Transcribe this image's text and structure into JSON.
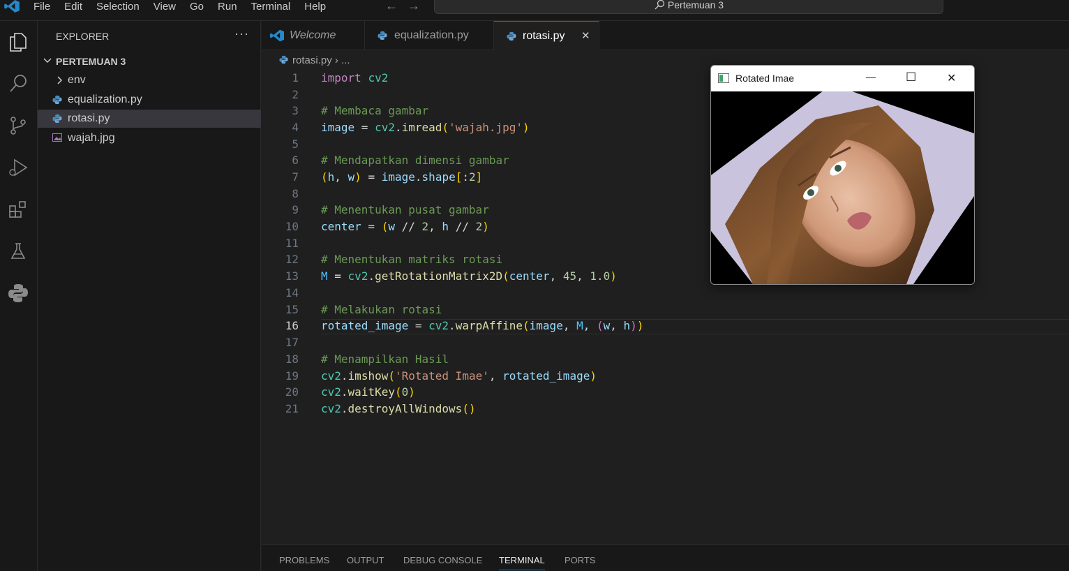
{
  "app": {
    "menu": [
      "File",
      "Edit",
      "Selection",
      "View",
      "Go",
      "Run",
      "Terminal",
      "Help"
    ],
    "search_text": "Pertemuan 3"
  },
  "activity_bar": [
    "explorer-icon",
    "search-icon",
    "source-control-icon",
    "run-debug-icon",
    "extensions-icon",
    "testing-icon",
    "python-icon"
  ],
  "sidebar": {
    "title": "EXPLORER",
    "more": "···",
    "folder": "PERTEMUAN 3",
    "items": [
      {
        "label": "env",
        "type": "folder"
      },
      {
        "label": "equalization.py",
        "type": "python"
      },
      {
        "label": "rotasi.py",
        "type": "python",
        "selected": true
      },
      {
        "label": "wajah.jpg",
        "type": "image"
      }
    ]
  },
  "tabs": [
    {
      "label": "Welcome",
      "icon": "vscode-icon"
    },
    {
      "label": "equalization.py",
      "icon": "python-icon"
    },
    {
      "label": "rotasi.py",
      "icon": "python-icon",
      "active": true,
      "close": "✕"
    }
  ],
  "breadcrumb": {
    "file": "rotasi.py",
    "sep": "›",
    "rest": "..."
  },
  "editor": {
    "current_line": 16,
    "lines": [
      "import cv2",
      "",
      "# Membaca gambar",
      "image = cv2.imread('wajah.jpg')",
      "",
      "# Mendapatkan dimensi gambar",
      "(h, w) = image.shape[:2]",
      "",
      "# Menentukan pusat gambar",
      "center = (w // 2, h // 2)",
      "",
      "# Menentukan matriks rotasi",
      "M = cv2.getRotationMatrix2D(center, 45, 1.0)",
      "",
      "# Melakukan rotasi",
      "rotated_image = cv2.warpAffine(image, M, (w, h))",
      "",
      "# Menampilkan Hasil",
      "cv2.imshow('Rotated Imae', rotated_image)",
      "cv2.waitKey(0)",
      "cv2.destroyAllWindows()"
    ]
  },
  "panel_tabs": [
    "PROBLEMS",
    "OUTPUT",
    "DEBUG CONSOLE",
    "TERMINAL",
    "PORTS"
  ],
  "panel_active": "TERMINAL",
  "cv_window": {
    "title": "Rotated Imae",
    "minimize": "—",
    "maximize": "☐",
    "close": "✕"
  },
  "colors": {
    "accent": "#0078d4",
    "editor_bg": "#1f1f1f",
    "sidebar_bg": "#181818"
  }
}
